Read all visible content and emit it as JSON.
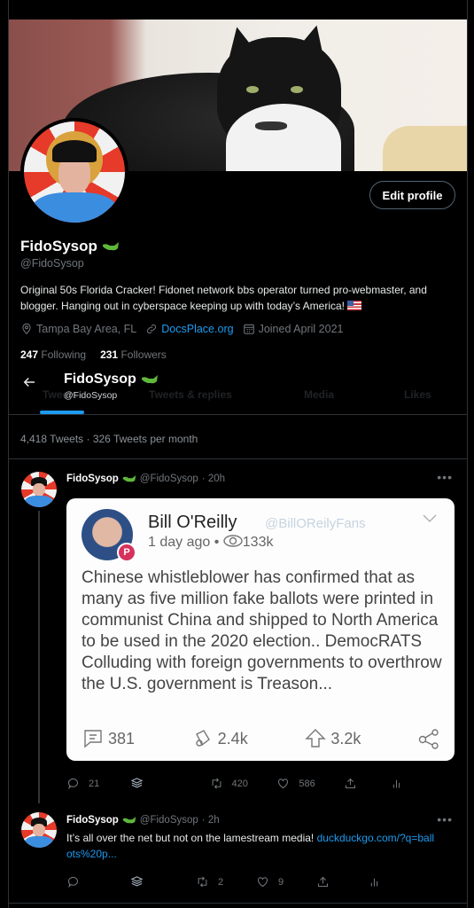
{
  "profile": {
    "display_name": "FidoSysop",
    "handle": "@FidoSysop",
    "edit_profile_label": "Edit profile",
    "bio": "Original 50s Florida Cracker! Fidonet network bbs operator turned pro-webmaster, and blogger. Hanging out in cyberspace keeping up with today’s America!",
    "location": "Tampa Bay Area, FL",
    "website": "DocsPlace.org",
    "joined": "Joined April 2021",
    "following_count": "247",
    "following_label": "Following",
    "followers_count": "231",
    "followers_label": "Followers",
    "badge_icon": "alligator-emoji",
    "bio_emoji": "us-flag-emoji"
  },
  "sticky_header": {
    "name": "FidoSysop",
    "handle": "@FidoSysop"
  },
  "tabs": [
    {
      "label": "Tweets",
      "active": true
    },
    {
      "label": "Tweets & replies",
      "active": false
    },
    {
      "label": "Media",
      "active": false
    },
    {
      "label": "Likes",
      "active": false
    }
  ],
  "stats_line": "4,418 Tweets · 326 Tweets per month",
  "tweets": [
    {
      "name": "FidoSysop",
      "handle": "@FidoSysop",
      "time": "· 20h",
      "text": "",
      "embedded_image": {
        "author": "Bill O'Reilly",
        "handle": "@BillOReilyFans",
        "time": "1 day ago •",
        "views": "133k",
        "text": "Chinese whistleblower has confirmed that as many as five million fake ballots were printed in communist China and shipped to North America to be used in the 2020 election.. DemocRATS Colluding with foreign governments to overthrow the U.S. government is Treason...",
        "comments": "381",
        "echoes": "2.4k",
        "upvotes": "3.2k",
        "badge": "P"
      },
      "replies": "21",
      "retweets": "420",
      "likes": "586"
    },
    {
      "name": "FidoSysop",
      "handle": "@FidoSysop",
      "time": "· 2h",
      "text": "It’s all over the net but not on the lamestream media! ",
      "link": "duckduckgo.com/?q=ballots%20p...",
      "replies": "",
      "retweets": "2",
      "likes": "9"
    }
  ],
  "colors": {
    "accent": "#1d9bf0",
    "background": "#000000",
    "muted": "#71767b",
    "border": "#2f3336"
  }
}
